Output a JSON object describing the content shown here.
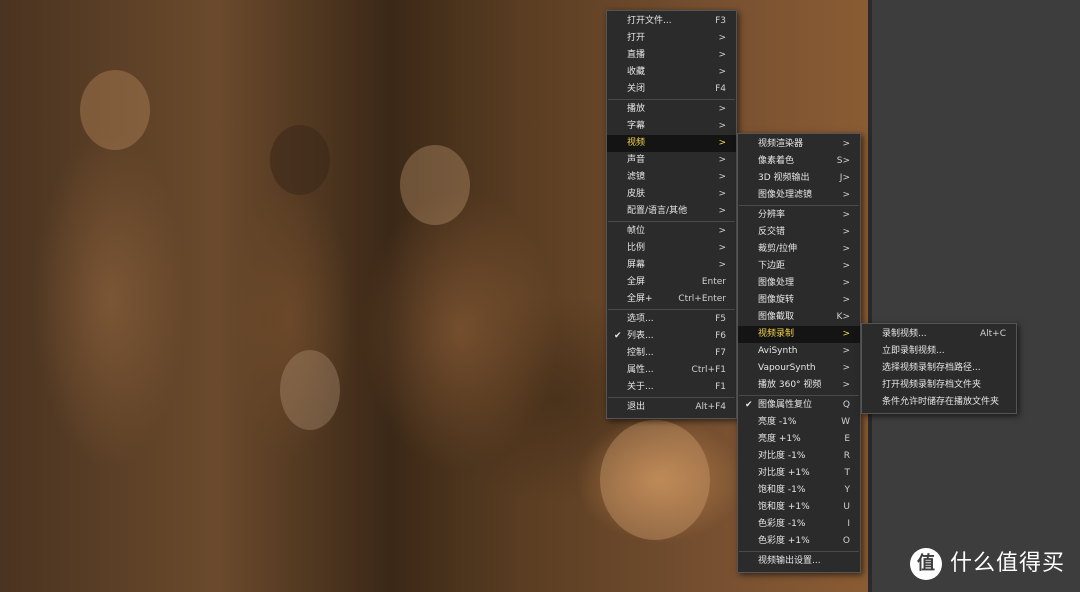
{
  "main_menu": [
    {
      "label": "打开文件...",
      "shortcut": "F3"
    },
    {
      "label": "打开",
      "shortcut": ">"
    },
    {
      "label": "直播",
      "shortcut": ">"
    },
    {
      "label": "收藏",
      "shortcut": ">"
    },
    {
      "label": "关闭",
      "shortcut": "F4"
    },
    {
      "sep": true
    },
    {
      "label": "播放",
      "shortcut": ">"
    },
    {
      "label": "字幕",
      "shortcut": ">"
    },
    {
      "label": "视频",
      "shortcut": ">",
      "active": true
    },
    {
      "label": "声音",
      "shortcut": ">"
    },
    {
      "label": "滤镜",
      "shortcut": ">"
    },
    {
      "label": "皮肤",
      "shortcut": ">"
    },
    {
      "label": "配置/语言/其他",
      "shortcut": ">"
    },
    {
      "sep": true
    },
    {
      "label": "帧位",
      "shortcut": ">"
    },
    {
      "label": "比例",
      "shortcut": ">"
    },
    {
      "label": "屏幕",
      "shortcut": ">"
    },
    {
      "label": "全屏",
      "shortcut": "Enter"
    },
    {
      "label": "全屏+",
      "shortcut": "Ctrl+Enter"
    },
    {
      "sep": true
    },
    {
      "label": "选项...",
      "shortcut": "F5"
    },
    {
      "label": "列表...",
      "shortcut": "F6",
      "checked": true
    },
    {
      "label": "控制...",
      "shortcut": "F7"
    },
    {
      "label": "属性...",
      "shortcut": "Ctrl+F1"
    },
    {
      "label": "关于...",
      "shortcut": "F1"
    },
    {
      "sep": true
    },
    {
      "label": "退出",
      "shortcut": "Alt+F4"
    }
  ],
  "video_menu": [
    {
      "label": "视频渲染器",
      "shortcut": ">"
    },
    {
      "label": "像素着色",
      "shortcut": "S>"
    },
    {
      "label": "3D 视频输出",
      "shortcut": "J>"
    },
    {
      "label": "图像处理滤镜",
      "shortcut": ">"
    },
    {
      "sep": true
    },
    {
      "label": "分辨率",
      "shortcut": ">"
    },
    {
      "label": "反交错",
      "shortcut": ">"
    },
    {
      "label": "裁剪/拉伸",
      "shortcut": ">"
    },
    {
      "label": "下边距",
      "shortcut": ">"
    },
    {
      "label": "图像处理",
      "shortcut": ">"
    },
    {
      "label": "图像旋转",
      "shortcut": ">"
    },
    {
      "label": "图像截取",
      "shortcut": "K>"
    },
    {
      "label": "视频录制",
      "shortcut": ">",
      "active": true
    },
    {
      "label": "AviSynth",
      "shortcut": ">"
    },
    {
      "label": "VapourSynth",
      "shortcut": ">"
    },
    {
      "label": "播放 360° 视频",
      "shortcut": ">"
    },
    {
      "sep": true
    },
    {
      "label": "图像属性复位",
      "shortcut": "Q",
      "checked": true
    },
    {
      "label": "亮度 -1%",
      "shortcut": "W"
    },
    {
      "label": "亮度 +1%",
      "shortcut": "E"
    },
    {
      "label": "对比度 -1%",
      "shortcut": "R"
    },
    {
      "label": "对比度 +1%",
      "shortcut": "T"
    },
    {
      "label": "饱和度 -1%",
      "shortcut": "Y"
    },
    {
      "label": "饱和度 +1%",
      "shortcut": "U"
    },
    {
      "label": "色彩度 -1%",
      "shortcut": "I"
    },
    {
      "label": "色彩度 +1%",
      "shortcut": "O"
    },
    {
      "sep": true
    },
    {
      "label": "视频输出设置...",
      "shortcut": ""
    }
  ],
  "record_menu": [
    {
      "label": "录制视频...",
      "shortcut": "Alt+C"
    },
    {
      "label": "立即录制视频...",
      "shortcut": ""
    },
    {
      "label": "选择视频录制存档路径...",
      "shortcut": ""
    },
    {
      "label": "打开视频录制存档文件夹",
      "shortcut": ""
    },
    {
      "label": "条件允许时储存在播放文件夹",
      "shortcut": ""
    }
  ],
  "watermark": {
    "icon_char": "值",
    "text": "什么值得买"
  },
  "colors": {
    "menu_bg": "#2b2b2b",
    "active_text": "#f3d64a",
    "active_bg": "#141414"
  },
  "check_glyph": "✔"
}
